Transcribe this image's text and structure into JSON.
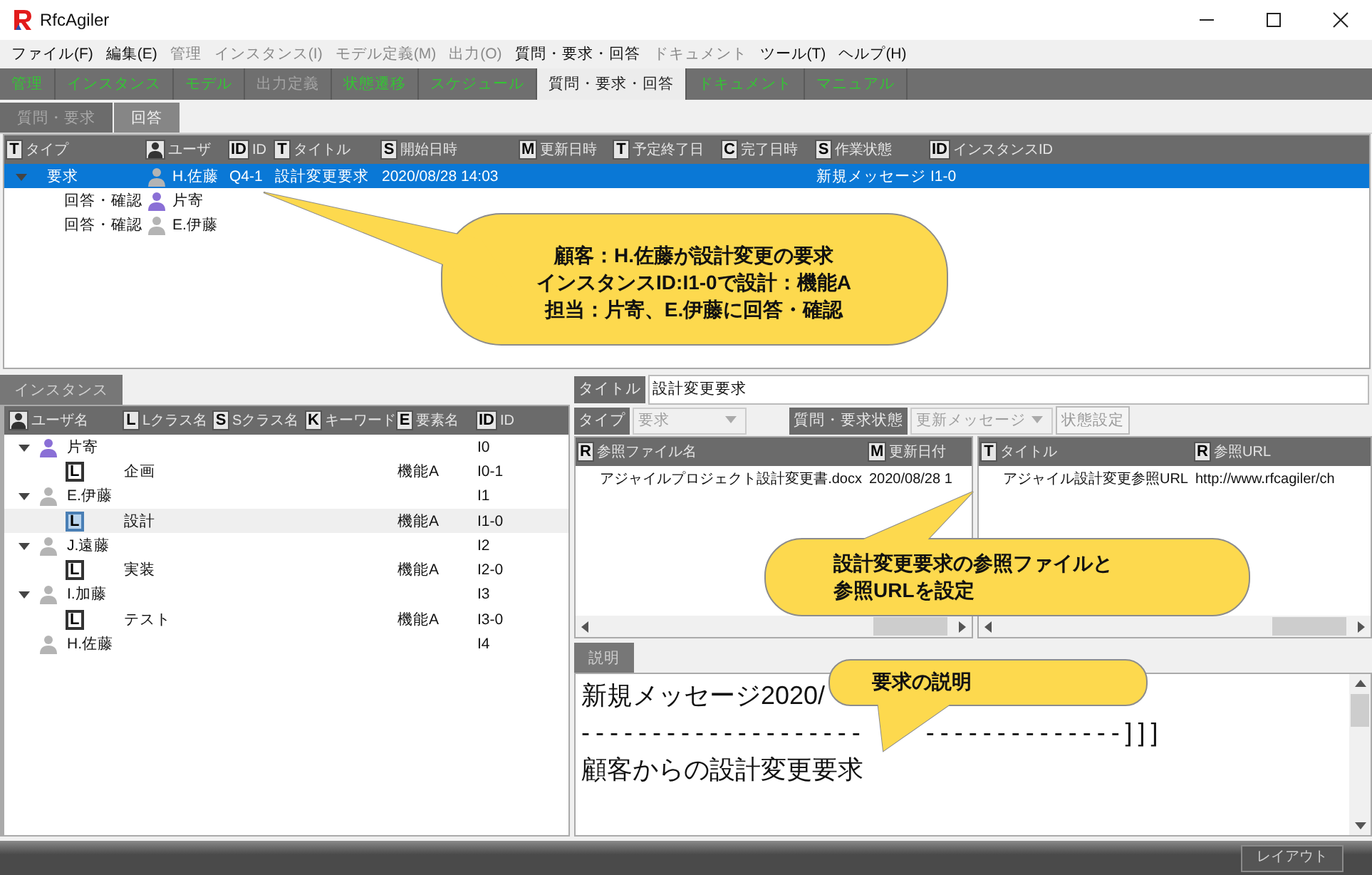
{
  "window": {
    "title": "RfcAgiler"
  },
  "menu": [
    {
      "label": "ファイル(F)",
      "disabled": false
    },
    {
      "label": "編集(E)",
      "disabled": false
    },
    {
      "label": "管理",
      "disabled": true
    },
    {
      "label": "インスタンス(I)",
      "disabled": true
    },
    {
      "label": "モデル定義(M)",
      "disabled": true
    },
    {
      "label": "出力(O)",
      "disabled": true
    },
    {
      "label": "質問・要求・回答",
      "disabled": false
    },
    {
      "label": "ドキュメント",
      "disabled": true
    },
    {
      "label": "ツール(T)",
      "disabled": false
    },
    {
      "label": "ヘルプ(H)",
      "disabled": false
    }
  ],
  "module_tabs": [
    {
      "label": "管理",
      "selected": false,
      "disabled": false
    },
    {
      "label": "インスタンス",
      "selected": false,
      "disabled": false
    },
    {
      "label": "モデル",
      "selected": false,
      "disabled": false
    },
    {
      "label": "出力定義",
      "selected": false,
      "disabled": true
    },
    {
      "label": "状態遷移",
      "selected": false,
      "disabled": false
    },
    {
      "label": "スケジュール",
      "selected": false,
      "disabled": false
    },
    {
      "label": "質問・要求・回答",
      "selected": true,
      "disabled": false
    },
    {
      "label": "ドキュメント",
      "selected": false,
      "disabled": false
    },
    {
      "label": "マニュアル",
      "selected": false,
      "disabled": false
    }
  ],
  "sub_tabs": [
    {
      "label": "質問・要求",
      "selected": false
    },
    {
      "label": "回答",
      "selected": true
    }
  ],
  "request_tree": {
    "columns": [
      {
        "kind": "letter",
        "badge": "T",
        "label": "タイプ"
      },
      {
        "kind": "user",
        "label": "ユーザ"
      },
      {
        "kind": "letter",
        "badge": "ID",
        "label": "ID"
      },
      {
        "kind": "letter",
        "badge": "T",
        "label": "タイトル"
      },
      {
        "kind": "letter",
        "badge": "S",
        "label": "開始日時"
      },
      {
        "kind": "letter",
        "badge": "M",
        "label": "更新日時"
      },
      {
        "kind": "letter",
        "badge": "T",
        "label": "予定終了日"
      },
      {
        "kind": "letter",
        "badge": "C",
        "label": "完了日時"
      },
      {
        "kind": "letter",
        "badge": "S",
        "label": "作業状態"
      },
      {
        "kind": "letter",
        "badge": "ID",
        "label": "インスタンスID"
      }
    ],
    "rows": [
      {
        "type": "要求",
        "user": "H.佐藤",
        "color": "#b4b4b4",
        "id": "Q4-1",
        "title": "設計変更要求",
        "start": "2020/08/28 14:03",
        "status": "新規メッセージ",
        "instance_id": "I1-0",
        "selected": true,
        "expanded": true,
        "children": [
          {
            "type": "回答・確認",
            "user": "片寄",
            "color": "#8a6fd6",
            "selected": false
          },
          {
            "type": "回答・確認",
            "user": "E.伊藤",
            "color": "#b4b4b4",
            "selected": false
          }
        ]
      }
    ]
  },
  "instance_panel": {
    "tab": "インスタンス",
    "columns": [
      {
        "kind": "user",
        "label": "ユーザ名"
      },
      {
        "kind": "letter",
        "badge": "L",
        "label": "Lクラス名"
      },
      {
        "kind": "letter",
        "badge": "S",
        "label": "Sクラス名"
      },
      {
        "kind": "letter",
        "badge": "K",
        "label": "キーワード"
      },
      {
        "kind": "letter",
        "badge": "E",
        "label": "要素名"
      },
      {
        "kind": "letter",
        "badge": "ID",
        "label": "ID"
      }
    ],
    "rows": [
      {
        "user": "片寄",
        "color": "#8a6fd6",
        "id": "I0",
        "expanded": true,
        "children": [
          {
            "badge": "L",
            "lclass": "企画",
            "element": "機能A",
            "id": "I0-1",
            "selected": false
          }
        ]
      },
      {
        "user": "E.伊藤",
        "color": "#b4b4b4",
        "id": "I1",
        "expanded": true,
        "children": [
          {
            "badge": "L",
            "lclass": "設計",
            "element": "機能A",
            "id": "I1-0",
            "selected": true
          }
        ]
      },
      {
        "user": "J.遠藤",
        "color": "#b4b4b4",
        "id": "I2",
        "expanded": true,
        "children": [
          {
            "badge": "L",
            "lclass": "実装",
            "element": "機能A",
            "id": "I2-0",
            "selected": false
          }
        ]
      },
      {
        "user": "I.加藤",
        "color": "#b4b4b4",
        "id": "I3",
        "expanded": true,
        "children": [
          {
            "badge": "L",
            "lclass": "テスト",
            "element": "機能A",
            "id": "I3-0",
            "selected": false
          }
        ]
      },
      {
        "user": "H.佐藤",
        "color": "#b4b4b4",
        "id": "I4"
      }
    ]
  },
  "detail": {
    "title_label": "タイトル",
    "title_value": "設計変更要求",
    "type_label": "タイプ",
    "type_value": "要求",
    "type_disabled": true,
    "status_label": "質問・要求状態",
    "status_value": "更新メッセージ",
    "status_disabled": true,
    "set_status_button": {
      "label": "状態設定",
      "disabled": true
    },
    "files": {
      "columns": [
        {
          "badge": "R",
          "label": "参照ファイル名"
        },
        {
          "badge": "M",
          "label": "更新日付"
        }
      ],
      "rows": [
        {
          "name": "アジャイルプロジェクト設計変更書.docx",
          "date": "2020/08/28 1"
        }
      ]
    },
    "urls": {
      "columns": [
        {
          "badge": "T",
          "label": "タイトル"
        },
        {
          "badge": "R",
          "label": "参照URL"
        }
      ],
      "rows": [
        {
          "title": "アジャイル設計変更参照URL",
          "url": "http://www.rfcagiler/ch"
        }
      ]
    },
    "description": {
      "tab": "説明",
      "lines": [
        [
          "新規メッセージ2020/"
        ],
        [
          "--------------------",
          "--------------]]]"
        ],
        [
          "顧客からの設計変更要求"
        ]
      ]
    }
  },
  "status_bar": {
    "layout_button": "レイアウト"
  },
  "callouts": [
    {
      "lines": [
        "顧客：H.佐藤が設計変更の要求",
        "インスタンスID:I1-0で設計：機能A",
        "担当：片寄、E.伊藤に回答・確認"
      ]
    },
    {
      "lines": [
        "設計変更要求の参照ファイルと",
        "参照URLを設定"
      ]
    },
    {
      "lines": [
        "要求の説明"
      ]
    }
  ]
}
